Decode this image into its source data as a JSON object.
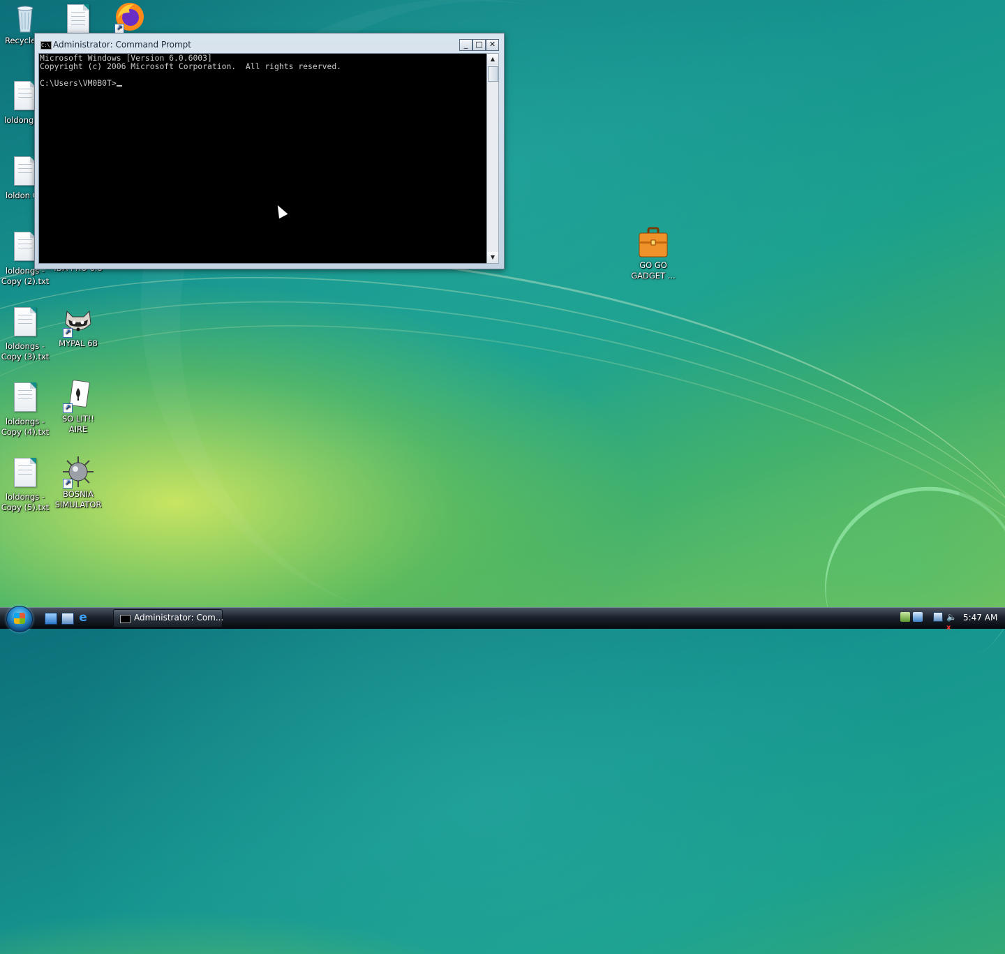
{
  "desktop_icons": [
    {
      "id": "recycle",
      "label": "Recycle",
      "icon": "recycle-bin-icon"
    },
    {
      "id": "file-top",
      "label": "",
      "icon": "text-file-icon"
    },
    {
      "id": "firefox",
      "label": "",
      "icon": "firefox-icon"
    },
    {
      "id": "loldongs",
      "label": "loldong",
      "icon": "text-file-icon"
    },
    {
      "id": "loldongs-copy",
      "label": "loldon Copy.",
      "icon": "text-file-icon"
    },
    {
      "id": "loldongs-copy2",
      "label": "loldongs - Copy (2).txt",
      "icon": "text-file-icon"
    },
    {
      "id": "loldongs-copy3",
      "label": "loldongs - Copy (3).txt",
      "icon": "text-file-icon"
    },
    {
      "id": "mypal",
      "label": "MYPAL 68",
      "icon": "raccoon-icon"
    },
    {
      "id": "loldongs-copy4",
      "label": "loldongs - Copy (4).txt",
      "icon": "text-file-icon"
    },
    {
      "id": "solitaire",
      "label": "SO LIT!! AIRE",
      "icon": "playing-card-icon"
    },
    {
      "id": "loldongs-copy5",
      "label": "loldongs - Copy (5).txt",
      "icon": "text-file-icon"
    },
    {
      "id": "bosnia",
      "label": "BOSNIA SIMULATOR",
      "icon": "mine-icon"
    },
    {
      "id": "ida",
      "label": "IDA PRO 6.8",
      "icon": "ida-icon"
    },
    {
      "id": "gadget",
      "label": "GO GO GADGET ...",
      "icon": "briefcase-icon"
    }
  ],
  "cmd_window": {
    "title": "Administrator: Command Prompt",
    "min_label": "_",
    "max_label": "□",
    "close_label": "✕",
    "lines": [
      "Microsoft Windows [Version 6.0.6003]",
      "Copyright (c) 2006 Microsoft Corporation.  All rights reserved.",
      "",
      "C:\\Users\\VM0B0T>"
    ],
    "scroll_up": "▲",
    "scroll_down": "▼"
  },
  "taskbar": {
    "task_label": "Administrator: Com...",
    "clock": "5:47 AM",
    "ie_glyph": "e",
    "volume_glyph": "🔈",
    "mute_glyph": "x"
  }
}
